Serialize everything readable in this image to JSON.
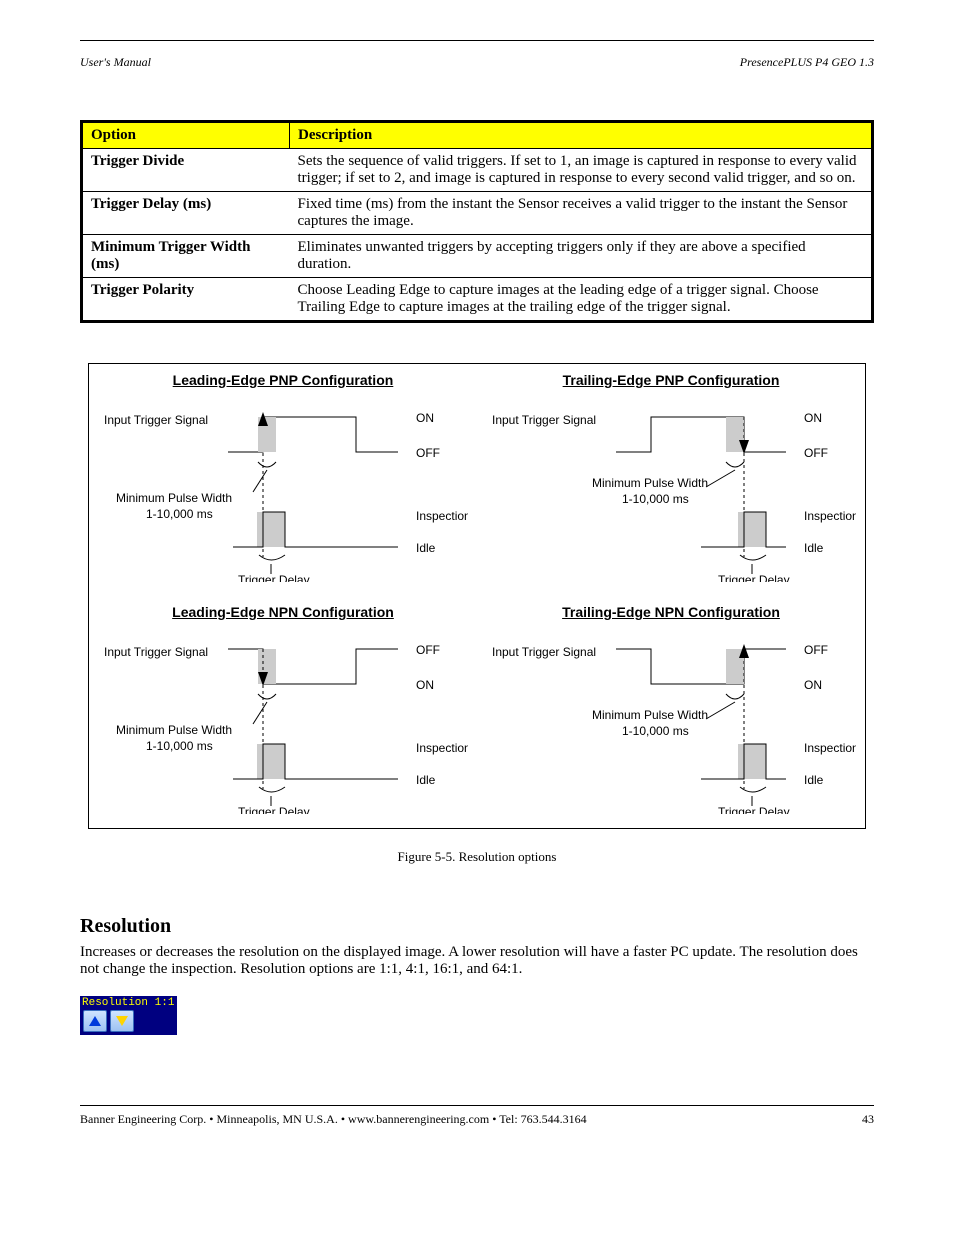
{
  "header": {
    "left": "User's Manual",
    "right": "PresencePLUS P4 GEO 1.3"
  },
  "table": {
    "head_option": "Option",
    "head_desc": "Description",
    "rows": [
      {
        "opt": "Trigger Divide",
        "desc": "Sets the sequence of valid triggers. If set to 1, an image is captured in response to every valid trigger; if set to 2, and image is captured in response to every second valid trigger, and so on."
      },
      {
        "opt": "Trigger Delay (ms)",
        "desc": "Fixed time (ms) from the instant the Sensor receives a valid trigger to the instant the Sensor captures the image."
      },
      {
        "opt": "Minimum Trigger Width (ms)",
        "desc": "Eliminates unwanted triggers by accepting triggers only if they are above a specified duration."
      },
      {
        "opt": "Trigger Polarity",
        "desc": "Choose Leading Edge to capture images at the leading edge of a trigger signal. Choose Trailing Edge to capture images at the trailing edge of the trigger signal."
      }
    ]
  },
  "diagram": {
    "titles": {
      "tl": "Leading-Edge PNP Configuration",
      "tr": "Trailing-Edge PNP Configuration",
      "bl": "Leading-Edge NPN Configuration",
      "br": "Trailing-Edge NPN Configuration"
    },
    "labels": {
      "input_sig": "Input Trigger Signal",
      "on": "ON",
      "off": "OFF",
      "min_pulse_l1": "Minimum Pulse Width",
      "min_pulse_l2": "1-10,000 ms",
      "inspection": "Inspection",
      "idle": "Idle",
      "trig_delay": "Trigger Delay"
    },
    "caption": "Figure 5-5. Resolution options"
  },
  "resolution": {
    "heading": "Resolution",
    "body": "Increases or decreases the resolution on the displayed image. A lower resolution will have a faster PC update. The resolution does not change the inspection. Resolution options are 1:1, 4:1, 16:1, and 64:1.",
    "widget_label": "Resolution 1:1"
  },
  "footer": {
    "left": "Banner Engineering Corp. • Minneapolis, MN U.S.A. • www.bannerengineering.com • Tel: 763.544.3164",
    "right": "43"
  }
}
